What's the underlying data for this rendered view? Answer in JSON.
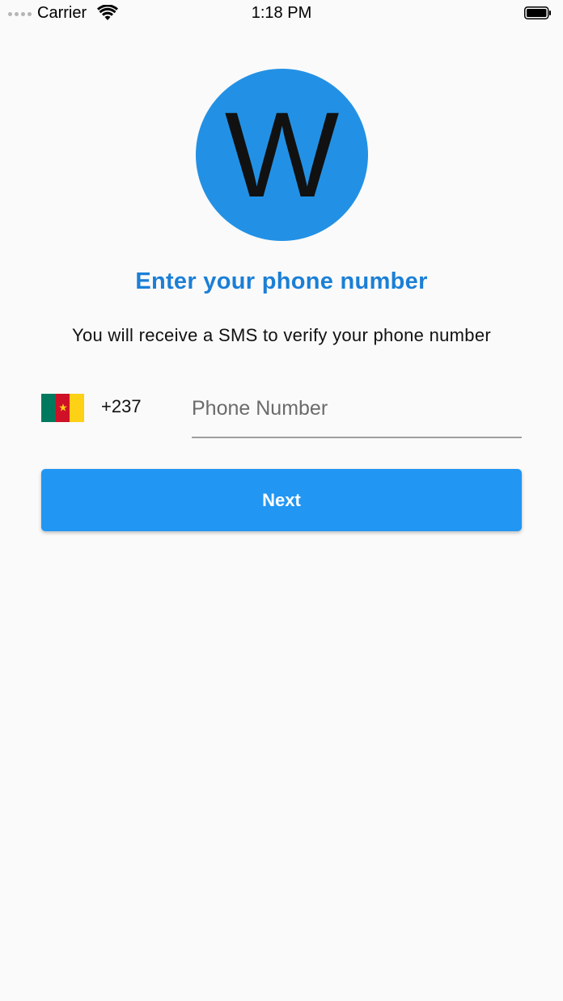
{
  "status_bar": {
    "carrier": "Carrier",
    "time": "1:18 PM",
    "icons": [
      "signal-dots-icon",
      "wifi-icon",
      "battery-icon"
    ]
  },
  "logo": {
    "letter": "W",
    "color": "#2291e5"
  },
  "title": "Enter your phone number",
  "subtitle": "You will receive a SMS to verify your phone number",
  "country": {
    "flag_icon": "cameroon-flag-icon",
    "flag_colors": [
      "#007a5e",
      "#ce1126",
      "#fcd116"
    ],
    "dial_code": "+237"
  },
  "phone_field": {
    "value": "",
    "placeholder": "Phone Number"
  },
  "next_button": {
    "label": "Next",
    "color": "#2196f3"
  },
  "colors": {
    "accent": "#1b7fd6",
    "background": "#fafafa"
  }
}
